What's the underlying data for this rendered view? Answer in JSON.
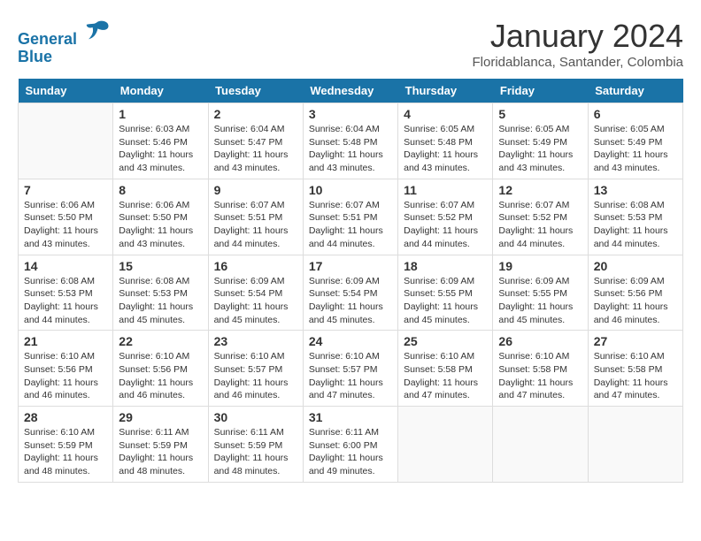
{
  "header": {
    "logo_line1": "General",
    "logo_line2": "Blue",
    "month": "January 2024",
    "location": "Floridablanca, Santander, Colombia"
  },
  "days_of_week": [
    "Sunday",
    "Monday",
    "Tuesday",
    "Wednesday",
    "Thursday",
    "Friday",
    "Saturday"
  ],
  "weeks": [
    [
      {
        "day": "",
        "detail": ""
      },
      {
        "day": "1",
        "detail": "Sunrise: 6:03 AM\nSunset: 5:46 PM\nDaylight: 11 hours\nand 43 minutes."
      },
      {
        "day": "2",
        "detail": "Sunrise: 6:04 AM\nSunset: 5:47 PM\nDaylight: 11 hours\nand 43 minutes."
      },
      {
        "day": "3",
        "detail": "Sunrise: 6:04 AM\nSunset: 5:48 PM\nDaylight: 11 hours\nand 43 minutes."
      },
      {
        "day": "4",
        "detail": "Sunrise: 6:05 AM\nSunset: 5:48 PM\nDaylight: 11 hours\nand 43 minutes."
      },
      {
        "day": "5",
        "detail": "Sunrise: 6:05 AM\nSunset: 5:49 PM\nDaylight: 11 hours\nand 43 minutes."
      },
      {
        "day": "6",
        "detail": "Sunrise: 6:05 AM\nSunset: 5:49 PM\nDaylight: 11 hours\nand 43 minutes."
      }
    ],
    [
      {
        "day": "7",
        "detail": "Sunrise: 6:06 AM\nSunset: 5:50 PM\nDaylight: 11 hours\nand 43 minutes."
      },
      {
        "day": "8",
        "detail": "Sunrise: 6:06 AM\nSunset: 5:50 PM\nDaylight: 11 hours\nand 43 minutes."
      },
      {
        "day": "9",
        "detail": "Sunrise: 6:07 AM\nSunset: 5:51 PM\nDaylight: 11 hours\nand 44 minutes."
      },
      {
        "day": "10",
        "detail": "Sunrise: 6:07 AM\nSunset: 5:51 PM\nDaylight: 11 hours\nand 44 minutes."
      },
      {
        "day": "11",
        "detail": "Sunrise: 6:07 AM\nSunset: 5:52 PM\nDaylight: 11 hours\nand 44 minutes."
      },
      {
        "day": "12",
        "detail": "Sunrise: 6:07 AM\nSunset: 5:52 PM\nDaylight: 11 hours\nand 44 minutes."
      },
      {
        "day": "13",
        "detail": "Sunrise: 6:08 AM\nSunset: 5:53 PM\nDaylight: 11 hours\nand 44 minutes."
      }
    ],
    [
      {
        "day": "14",
        "detail": "Sunrise: 6:08 AM\nSunset: 5:53 PM\nDaylight: 11 hours\nand 44 minutes."
      },
      {
        "day": "15",
        "detail": "Sunrise: 6:08 AM\nSunset: 5:53 PM\nDaylight: 11 hours\nand 45 minutes."
      },
      {
        "day": "16",
        "detail": "Sunrise: 6:09 AM\nSunset: 5:54 PM\nDaylight: 11 hours\nand 45 minutes."
      },
      {
        "day": "17",
        "detail": "Sunrise: 6:09 AM\nSunset: 5:54 PM\nDaylight: 11 hours\nand 45 minutes."
      },
      {
        "day": "18",
        "detail": "Sunrise: 6:09 AM\nSunset: 5:55 PM\nDaylight: 11 hours\nand 45 minutes."
      },
      {
        "day": "19",
        "detail": "Sunrise: 6:09 AM\nSunset: 5:55 PM\nDaylight: 11 hours\nand 45 minutes."
      },
      {
        "day": "20",
        "detail": "Sunrise: 6:09 AM\nSunset: 5:56 PM\nDaylight: 11 hours\nand 46 minutes."
      }
    ],
    [
      {
        "day": "21",
        "detail": "Sunrise: 6:10 AM\nSunset: 5:56 PM\nDaylight: 11 hours\nand 46 minutes."
      },
      {
        "day": "22",
        "detail": "Sunrise: 6:10 AM\nSunset: 5:56 PM\nDaylight: 11 hours\nand 46 minutes."
      },
      {
        "day": "23",
        "detail": "Sunrise: 6:10 AM\nSunset: 5:57 PM\nDaylight: 11 hours\nand 46 minutes."
      },
      {
        "day": "24",
        "detail": "Sunrise: 6:10 AM\nSunset: 5:57 PM\nDaylight: 11 hours\nand 47 minutes."
      },
      {
        "day": "25",
        "detail": "Sunrise: 6:10 AM\nSunset: 5:58 PM\nDaylight: 11 hours\nand 47 minutes."
      },
      {
        "day": "26",
        "detail": "Sunrise: 6:10 AM\nSunset: 5:58 PM\nDaylight: 11 hours\nand 47 minutes."
      },
      {
        "day": "27",
        "detail": "Sunrise: 6:10 AM\nSunset: 5:58 PM\nDaylight: 11 hours\nand 47 minutes."
      }
    ],
    [
      {
        "day": "28",
        "detail": "Sunrise: 6:10 AM\nSunset: 5:59 PM\nDaylight: 11 hours\nand 48 minutes."
      },
      {
        "day": "29",
        "detail": "Sunrise: 6:11 AM\nSunset: 5:59 PM\nDaylight: 11 hours\nand 48 minutes."
      },
      {
        "day": "30",
        "detail": "Sunrise: 6:11 AM\nSunset: 5:59 PM\nDaylight: 11 hours\nand 48 minutes."
      },
      {
        "day": "31",
        "detail": "Sunrise: 6:11 AM\nSunset: 6:00 PM\nDaylight: 11 hours\nand 49 minutes."
      },
      {
        "day": "",
        "detail": ""
      },
      {
        "day": "",
        "detail": ""
      },
      {
        "day": "",
        "detail": ""
      }
    ]
  ]
}
